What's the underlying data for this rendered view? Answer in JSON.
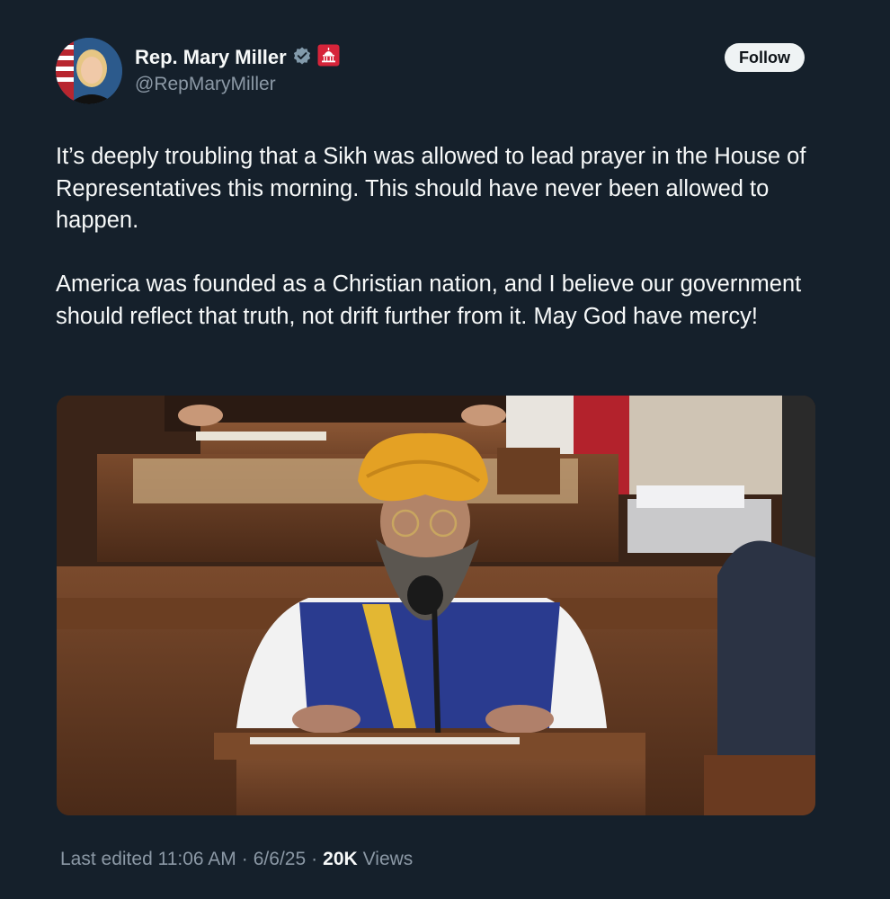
{
  "author": {
    "display_name": "Rep. Mary Miller",
    "handle": "@RepMaryMiller",
    "verified_badge_icon": "gray-check-badge-icon",
    "affiliation_icon": "us-capitol-icon"
  },
  "follow_button": {
    "label": "Follow"
  },
  "tweet": {
    "paragraphs": [
      "It’s deeply troubling that a Sikh was allowed to lead prayer in the House of Representatives this morning. This should have never been allowed to happen.",
      "America was founded as a Christian nation, and I believe our government should reflect that truth, not drift further from it. May God have mercy!"
    ]
  },
  "media": {
    "type": "image",
    "icon": "photo-of-sikh-chaplain-at-house-podium"
  },
  "meta": {
    "edited_label": "Last edited 11:06 AM",
    "date": "6/6/25",
    "views_count": "20K",
    "views_label": "Views"
  },
  "colors": {
    "background": "#15202b",
    "text": "#f7f9f9",
    "secondary": "#8b98a5",
    "follow_bg": "#eff3f4",
    "affiliation_badge": "#d6243a"
  }
}
